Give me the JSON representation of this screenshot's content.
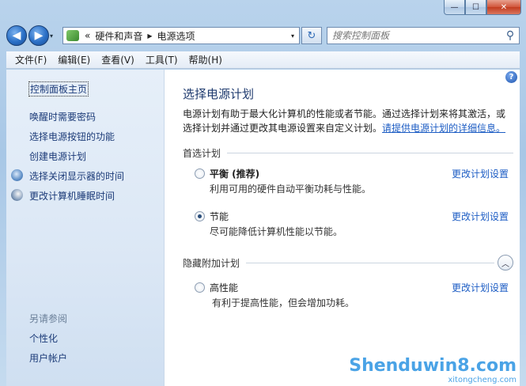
{
  "window": {
    "caption": {
      "minimize": "—",
      "maximize": "☐",
      "close": "✕"
    }
  },
  "nav": {
    "back_icon": "◀",
    "forward_icon": "▶",
    "history_dropdown": "▾",
    "address": {
      "overflow": "«",
      "crumbs": [
        "硬件和声音",
        "电源选项"
      ],
      "separator": "▶",
      "dropdown": "▾"
    },
    "refresh_icon": "↻",
    "search": {
      "placeholder": "搜索控制面板",
      "icon": "⚲"
    }
  },
  "menu": [
    "文件(F)",
    "编辑(E)",
    "查看(V)",
    "工具(T)",
    "帮助(H)"
  ],
  "sidebar": {
    "home": "控制面板主页",
    "links": [
      "唤醒时需要密码",
      "选择电源按钮的功能",
      "创建电源计划",
      "选择关闭显示器的时间",
      "更改计算机睡眠时间"
    ],
    "see_also_heading": "另请参阅",
    "see_also": [
      "个性化",
      "用户帐户"
    ]
  },
  "main": {
    "help_icon": "?",
    "title": "选择电源计划",
    "description": "电源计划有助于最大化计算机的性能或者节能。通过选择计划来将其激活，或选择计划并通过更改其电源设置来自定义计划。",
    "description_link": "请提供电源计划的详细信息。",
    "preferred_heading": "首选计划",
    "hidden_heading": "隐藏附加计划",
    "collapse_icon": "︿",
    "plans": [
      {
        "name": "平衡 (推荐)",
        "description": "利用可用的硬件自动平衡功耗与性能。",
        "change": "更改计划设置",
        "selected": false
      },
      {
        "name": "节能",
        "description": "尽可能降低计算机性能以节能。",
        "change": "更改计划设置",
        "selected": true
      },
      {
        "name": "高性能",
        "description": "有利于提高性能，但会增加功耗。",
        "change": "更改计划设置",
        "selected": false
      }
    ]
  },
  "watermark": {
    "big": "Shenduwin8.com",
    "small": "xitongcheng.com"
  }
}
